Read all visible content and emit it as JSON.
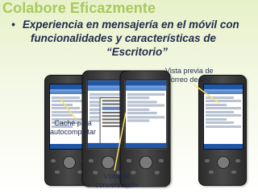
{
  "slide": {
    "title": "Colabore Eficazmente",
    "subtitle_lines": [
      "Experiencia en mensajería en el móvil con",
      "funcionalidades y características de",
      "“Escritorio”"
    ]
  },
  "callouts": {
    "voicemail_line1": "Vista previa de",
    "voicemail_line2": "correo de voz",
    "autocomplete_line1": "Caché para",
    "autocomplete_line2": "autocompletar",
    "conversation_line1": "Vista de",
    "conversation_line2": "conversación"
  },
  "colors": {
    "title": "#a9c85f",
    "text": "#1f2a4a",
    "screen_accent": "#1e56a8"
  }
}
